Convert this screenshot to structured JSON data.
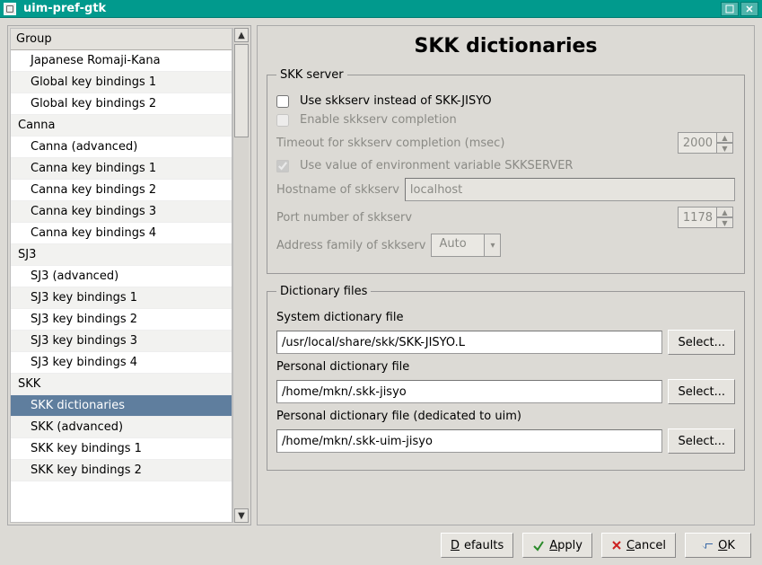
{
  "window": {
    "title": "uim-pref-gtk"
  },
  "sidebar": {
    "header": "Group",
    "items": [
      "Japanese Romaji-Kana",
      "Global key bindings 1",
      "Global key bindings 2",
      "Canna",
      "Canna (advanced)",
      "Canna key bindings 1",
      "Canna key bindings 2",
      "Canna key bindings 3",
      "Canna key bindings 4",
      "SJ3",
      "SJ3 (advanced)",
      "SJ3 key bindings 1",
      "SJ3 key bindings 2",
      "SJ3 key bindings 3",
      "SJ3 key bindings 4",
      "SKK",
      "SKK dictionaries",
      "SKK (advanced)",
      "SKK key bindings 1",
      "SKK key bindings 2"
    ],
    "selected_index": 16
  },
  "main": {
    "title": "SKK dictionaries"
  },
  "skk_server": {
    "legend": "SKK server",
    "use_skkserv_label": "Use skkserv instead of SKK-JISYO",
    "use_skkserv_checked": false,
    "enable_completion_label": "Enable skkserv completion",
    "enable_completion_checked": false,
    "timeout_label": "Timeout for skkserv completion (msec)",
    "timeout_value": "2000",
    "use_env_label": "Use value of environment variable SKKSERVER",
    "use_env_checked": true,
    "hostname_label": "Hostname of skkserv",
    "hostname_value": "localhost",
    "port_label": "Port number of skkserv",
    "port_value": "1178",
    "address_family_label": "Address family of skkserv",
    "address_family_value": "Auto"
  },
  "dict_files": {
    "legend": "Dictionary files",
    "system_label": "System dictionary file",
    "system_value": "/usr/local/share/skk/SKK-JISYO.L",
    "personal_label": "Personal dictionary file",
    "personal_value": "/home/mkn/.skk-jisyo",
    "personal_uim_label": "Personal dictionary file (dedicated to uim)",
    "personal_uim_value": "/home/mkn/.skk-uim-jisyo",
    "select_label": "Select..."
  },
  "buttons": {
    "defaults": "Defaults",
    "apply": "Apply",
    "cancel": "Cancel",
    "ok": "OK"
  }
}
